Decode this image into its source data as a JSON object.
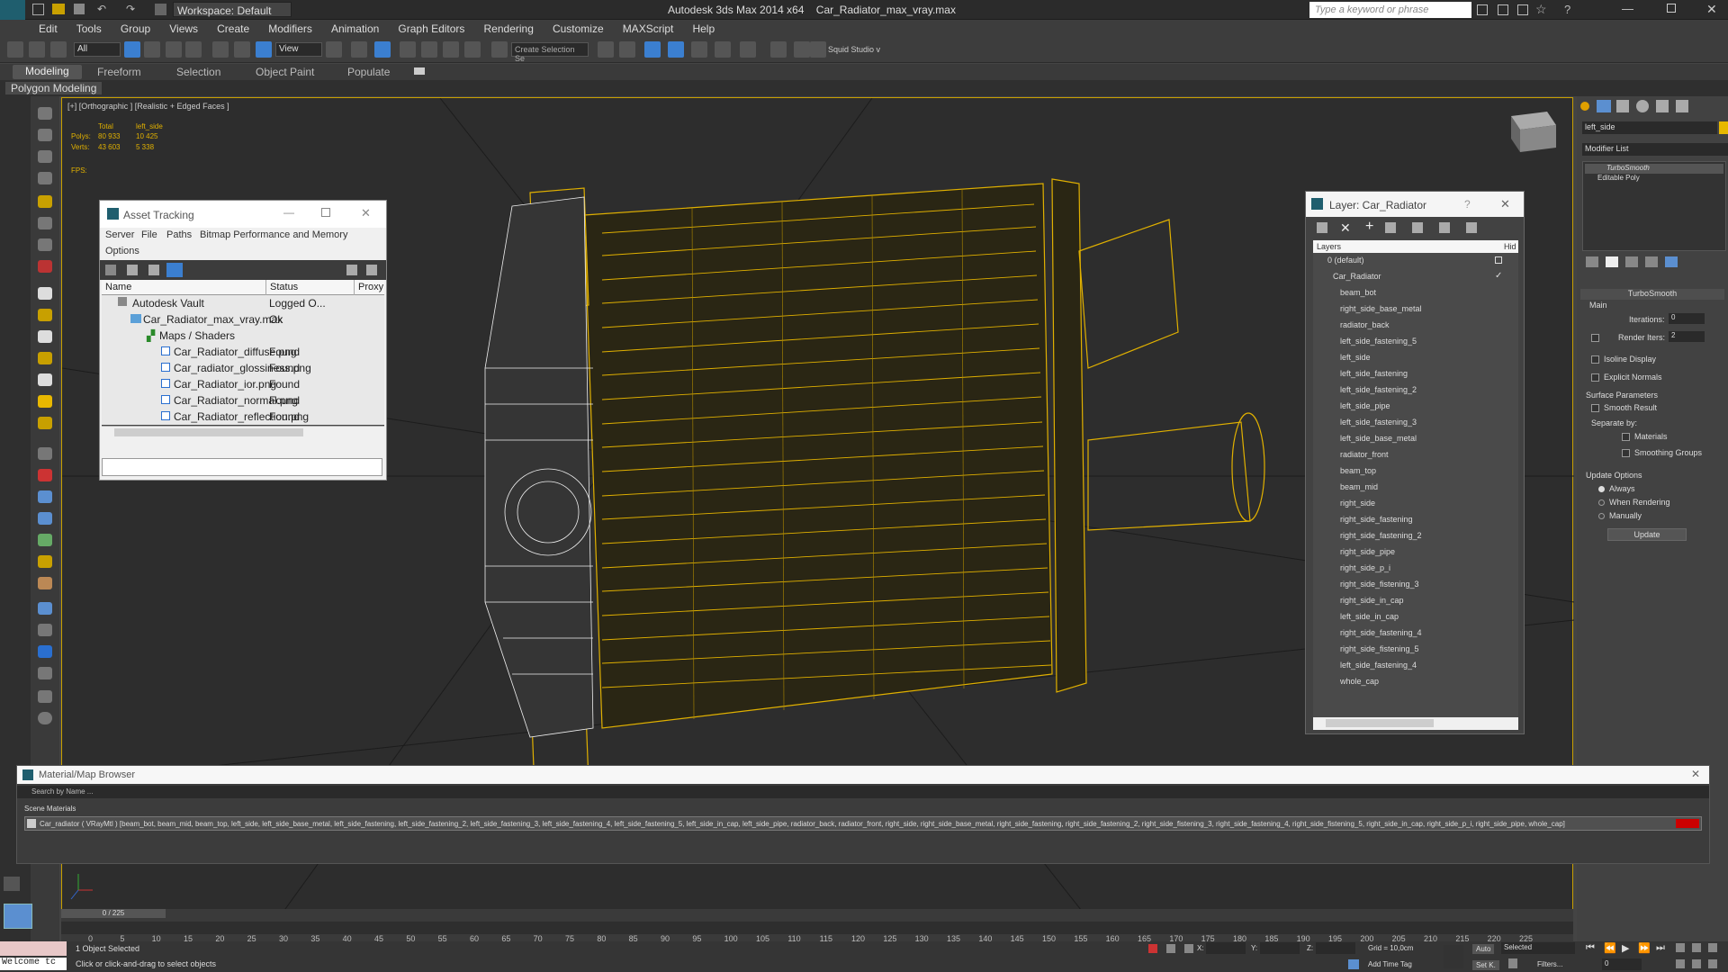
{
  "window": {
    "title": "Autodesk 3ds Max  2014 x64",
    "file": "Car_Radiator_max_vray.max",
    "workspace": "Workspace: Default",
    "search_placeholder": "Type a keyword or phrase"
  },
  "menu": [
    "Edit",
    "Tools",
    "Group",
    "Views",
    "Create",
    "Modifiers",
    "Animation",
    "Graph Editors",
    "Rendering",
    "Customize",
    "MAXScript",
    "Help"
  ],
  "toolbar": {
    "selection_filter": "All",
    "ref_coord": "View",
    "named_selection": "Create Selection Se",
    "squid_studio": "Squid Studio v"
  },
  "ribbon": {
    "tabs": [
      "Modeling",
      "Freeform",
      "Selection",
      "Object Paint",
      "Populate"
    ],
    "sub": "Polygon Modeling"
  },
  "viewport": {
    "label": "[+] [Orthographic ] [Realistic + Edged Faces ]",
    "stats_header_total": "Total",
    "stats_header_obj": "left_side",
    "polys_label": "Polys:",
    "polys_total": "80 933",
    "polys_obj": "10 425",
    "verts_label": "Verts:",
    "verts_total": "43 603",
    "verts_obj": "5 338",
    "fps_label": "FPS:"
  },
  "asset_tracking": {
    "title": "Asset Tracking",
    "menu": [
      "Server",
      "File",
      "Paths",
      "Bitmap Performance and Memory"
    ],
    "menu2": "Options",
    "columns": [
      "Name",
      "Status",
      "Proxy"
    ],
    "rows": [
      {
        "name": "Autodesk Vault",
        "status": "Logged O..."
      },
      {
        "name": "Car_Radiator_max_vray.max",
        "status": "Ok"
      },
      {
        "name": "Maps / Shaders",
        "status": ""
      },
      {
        "name": "Car_Radiator_diffuse.png",
        "status": "Found"
      },
      {
        "name": "Car_radiator_glossiness.png",
        "status": "Found"
      },
      {
        "name": "Car_Radiator_ior.png",
        "status": "Found"
      },
      {
        "name": "Car_Radiator_normal.png",
        "status": "Found"
      },
      {
        "name": "Car_Radiator_reflection.png",
        "status": "Found"
      }
    ]
  },
  "layer_window": {
    "title": "Layer: Car_Radiator",
    "help": "?",
    "col_layers": "Layers",
    "col_hide": "Hid",
    "items": [
      "0 (default)",
      "Car_Radiator",
      "beam_bot",
      "right_side_base_metal",
      "radiator_back",
      "left_side_fastening_5",
      "left_side",
      "left_side_fastening",
      "left_side_fastening_2",
      "left_side_pipe",
      "left_side_fastening_3",
      "left_side_base_metal",
      "radiator_front",
      "beam_top",
      "beam_mid",
      "right_side",
      "right_side_fastening",
      "right_side_fastening_2",
      "right_side_pipe",
      "right_side_p_i",
      "right_side_fistening_3",
      "right_side_in_cap",
      "left_side_in_cap",
      "right_side_fastening_4",
      "right_side_fistening_5",
      "left_side_fastening_4",
      "whole_cap"
    ]
  },
  "command_panel": {
    "object_name": "left_side",
    "modifier_list": "Modifier List",
    "stack": [
      "TurboSmooth",
      "Editable Poly"
    ],
    "rollout_title": "TurboSmooth",
    "main": "Main",
    "iterations_label": "Iterations:",
    "iterations": "0",
    "render_iters_label": "Render Iters:",
    "render_iters": "2",
    "isoline": "Isoline Display",
    "explicit": "Explicit Normals",
    "surface_params": "Surface Parameters",
    "smooth_result": "Smooth Result",
    "separate_by": "Separate by:",
    "materials": "Materials",
    "smoothing_groups": "Smoothing Groups",
    "update_options": "Update Options",
    "always": "Always",
    "when_rendering": "When Rendering",
    "manually": "Manually",
    "update_btn": "Update"
  },
  "material_browser": {
    "title": "Material/Map Browser",
    "search": "Search by Name ...",
    "group": "Scene Materials",
    "item": "Car_radiator  ( VRayMtl ) [beam_bot, beam_mid, beam_top, left_side, left_side_base_metal, left_side_fastening, left_side_fastening_2, left_side_fastening_3, left_side_fastening_4, left_side_fastening_5, left_side_in_cap, left_side_pipe, radiator_back, radiator_front, right_side, right_side_base_metal, right_side_fastening, right_side_fastening_2, right_side_fistening_3, right_side_fastening_4, right_side_fistening_5, right_side_in_cap, right_side_p_i, right_side_pipe, whole_cap]"
  },
  "timeline": {
    "frame": "0 / 225",
    "ticks": [
      "0",
      "5",
      "10",
      "15",
      "20",
      "25",
      "30",
      "35",
      "40",
      "45",
      "50",
      "55",
      "60",
      "65",
      "70",
      "75",
      "80",
      "85",
      "90",
      "95",
      "100",
      "105",
      "110",
      "115",
      "120",
      "125",
      "130",
      "135",
      "140",
      "145",
      "150",
      "155",
      "160",
      "165",
      "170",
      "175",
      "180",
      "185",
      "190",
      "195",
      "200",
      "205",
      "210",
      "215",
      "220",
      "225"
    ]
  },
  "status": {
    "welcome": "Welcome tc",
    "selected": "1 Object Selected",
    "hint": "Click or click-and-drag to select objects",
    "x": "X:",
    "y": "Y:",
    "z": "Z:",
    "grid": "Grid = 10,0cm",
    "add_time_tag": "Add Time Tag",
    "auto": "Auto",
    "selected_dd": "Selected",
    "setk": "Set K.",
    "filters": "Filters...",
    "frame_field": "0"
  },
  "colors": {
    "accent": "#c8a000",
    "wire": "#e0b000",
    "select_blue": "#3b7fd0"
  }
}
